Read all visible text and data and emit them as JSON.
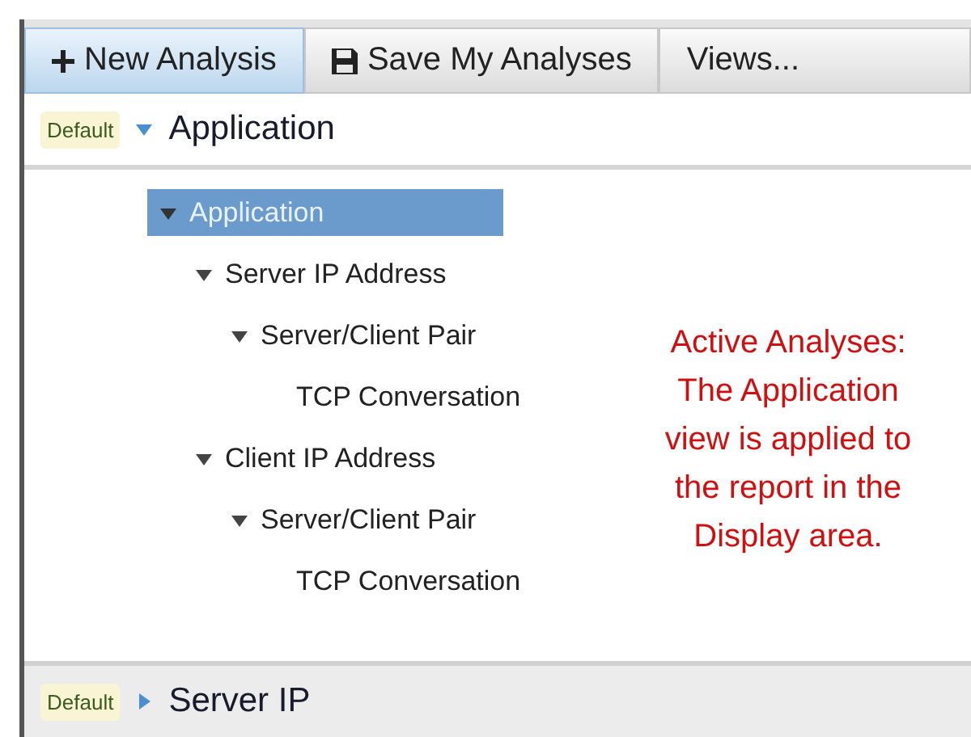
{
  "toolbar": [
    {
      "label": "New Analysis",
      "kind": "plus",
      "selected": true
    },
    {
      "label": "Save My Analyses",
      "kind": "save",
      "selected": false
    },
    {
      "label": "Views...",
      "kind": "text",
      "selected": false
    }
  ],
  "sections": [
    {
      "badge": "Default",
      "title": "Application",
      "expanded": true,
      "tree": [
        {
          "label": "Application",
          "selected": true,
          "expanded": true,
          "children": [
            {
              "label": "Server IP Address",
              "selected": false,
              "expanded": true,
              "children": [
                {
                  "label": "Server/Client Pair",
                  "selected": false,
                  "expanded": true,
                  "children": [
                    {
                      "label": "TCP Conversation",
                      "selected": false
                    }
                  ]
                }
              ]
            },
            {
              "label": "Client IP Address",
              "selected": false,
              "expanded": true,
              "children": [
                {
                  "label": "Server/Client Pair",
                  "selected": false,
                  "expanded": true,
                  "children": [
                    {
                      "label": "TCP Conversation",
                      "selected": false
                    }
                  ]
                }
              ]
            }
          ]
        }
      ],
      "note": "Active Analyses: The Application view is applied to the report in the Display area."
    },
    {
      "badge": "Default",
      "title": "Server IP",
      "expanded": false
    }
  ]
}
